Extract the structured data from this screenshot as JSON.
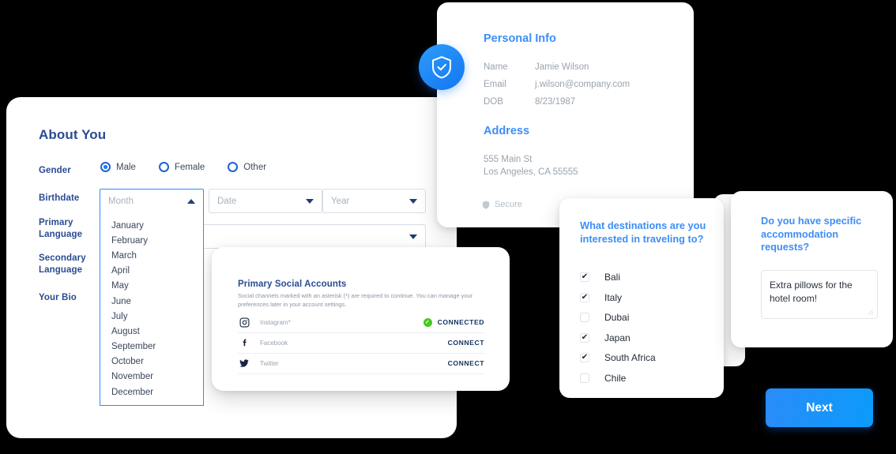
{
  "about_panel": {
    "title": "About You",
    "labels": {
      "gender": "Gender",
      "birthdate": "Birthdate",
      "primary_language": "Primary Language",
      "secondary_language": "Secondary Language",
      "your_bio": "Your Bio"
    },
    "gender_options": [
      {
        "label": "Male",
        "selected": true
      },
      {
        "label": "Female",
        "selected": false
      },
      {
        "label": "Other",
        "selected": false
      }
    ],
    "birthdate": {
      "month_placeholder": "Month",
      "date_placeholder": "Date",
      "year_placeholder": "Year",
      "month_open": true
    },
    "primary_language_value": "",
    "month_options": [
      "January",
      "February",
      "March",
      "April",
      "May",
      "June",
      "July",
      "August",
      "September",
      "October",
      "November",
      "December"
    ]
  },
  "social_card": {
    "title": "Primary Social Accounts",
    "subtitle": "Social channels marked with an asterisk (*) are required to continue. You can manage your preferences later in your account settings.",
    "rows": [
      {
        "icon": "instagram-icon",
        "name": "Instagram*",
        "action": "CONNECTED",
        "connected": true
      },
      {
        "icon": "facebook-icon",
        "name": "Facebook",
        "action": "CONNECT",
        "connected": false
      },
      {
        "icon": "twitter-icon",
        "name": "Twitter",
        "action": "CONNECT",
        "connected": false
      }
    ]
  },
  "personal_card": {
    "section_title": "Personal Info",
    "fields": [
      {
        "key": "Name",
        "value": "Jamie Wilson"
      },
      {
        "key": "Email",
        "value": "j.wilson@company.com"
      },
      {
        "key": "DOB",
        "value": "8/23/1987"
      }
    ],
    "address_title": "Address",
    "address": "555 Main St\nLos Angeles, CA 55555",
    "secure_label": "Secure",
    "badge_icon": "shield-check-icon"
  },
  "destinations_card": {
    "question": "What destinations are you interested in traveling to?",
    "options": [
      {
        "label": "Bali",
        "checked": true
      },
      {
        "label": "Italy",
        "checked": true
      },
      {
        "label": "Dubai",
        "checked": false
      },
      {
        "label": "Japan",
        "checked": true
      },
      {
        "label": "South Africa",
        "checked": true
      },
      {
        "label": "Chile",
        "checked": false
      }
    ]
  },
  "accommodation_card": {
    "question": "Do you have specific accommodation requests?",
    "textarea_value": "Extra pillows for the hotel room!",
    "textarea_placeholder": ""
  },
  "next_button": {
    "label": "Next"
  },
  "colors": {
    "accent_blue": "#3d8ef7",
    "navy": "#2a4b92",
    "deep_navy": "#14305e",
    "green": "#45c91c",
    "button_gradient_from": "#2a8cf7",
    "button_gradient_to": "#0b9bfb"
  }
}
